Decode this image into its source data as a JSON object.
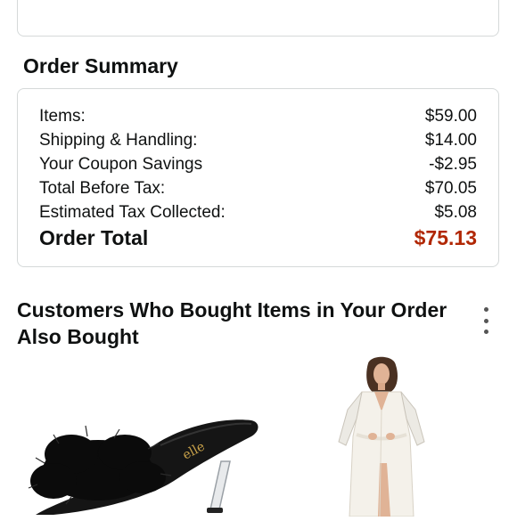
{
  "order_summary": {
    "title": "Order Summary",
    "rows": [
      {
        "label": "Items:",
        "value": "$59.00"
      },
      {
        "label": "Shipping & Handling:",
        "value": "$14.00"
      },
      {
        "label": "Your Coupon Savings",
        "value": "-$2.95"
      },
      {
        "label": "Total Before Tax:",
        "value": "$70.05"
      },
      {
        "label": "Estimated Tax Collected:",
        "value": "$5.08"
      }
    ],
    "total": {
      "label": "Order Total",
      "value": "$75.13"
    }
  },
  "recommendations": {
    "title": "Customers Who Bought Items in Your Order Also Bought",
    "menu_icon": "more-vertical-icon",
    "products": [
      {
        "image": "black-feather-heel-sandal"
      },
      {
        "image": "white-satin-robe-model"
      }
    ]
  },
  "colors": {
    "total_price": "#b12704",
    "border": "#d5d9d9",
    "text": "#0f1111"
  }
}
